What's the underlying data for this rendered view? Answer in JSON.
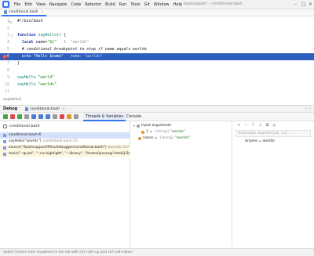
{
  "menubar": {
    "items": [
      "File",
      "Edit",
      "View",
      "Navigate",
      "Code",
      "Refactor",
      "Build",
      "Run",
      "Tools",
      "Git",
      "Window",
      "Help"
    ],
    "window_title": "bashsupport – conditional.bash"
  },
  "editor": {
    "tab_label": "conditional.bash",
    "lines": [
      {
        "n": "1",
        "text": "#!/bin/bash"
      },
      {
        "n": "2",
        "text": ""
      },
      {
        "n": "3",
        "text": "function sayHello() {"
      },
      {
        "n": "4",
        "text": "  local name=\"$1\"",
        "hint": "1: \"worlds\""
      },
      {
        "n": "5",
        "text": "  # conditional breakpoint to stop if name equals worlds"
      },
      {
        "n": "6",
        "text": "  echo \"Hello $name\"",
        "hint": "name: \"worlds\""
      },
      {
        "n": "7",
        "text": "}"
      },
      {
        "n": "8",
        "text": ""
      },
      {
        "n": "9",
        "text": "sayHello \"world\""
      },
      {
        "n": "10",
        "text": "sayHello \"worlds\""
      },
      {
        "n": "11",
        "text": ""
      }
    ],
    "breadcrumb": "sayHello()"
  },
  "debug": {
    "title": "Debug",
    "session_tab": "conditional.bash",
    "tabs": {
      "threads_variables": "Threads & Variables",
      "console": "Console"
    },
    "thread": "conditional.bash",
    "frames": [
      {
        "name": "conditional.bash:6",
        "loc": ""
      },
      {
        "name": "sayHello(\"worlds\")",
        "loc": "conditional.bash:10"
      },
      {
        "name": "source(\"/bashsupport/files/debugger/conditional.bash\")",
        "loc": "bashdb:107"
      },
      {
        "name": "main(\"--quiet\", \"--no-highlight\", \"--library\", \"/home/jansorg/.IntelliJ-Scr",
        "loc": ""
      }
    ],
    "variables": {
      "input_args_label": "Input arguments",
      "arg1_name": "1",
      "arg1_type": "{string}",
      "arg1_value": "\"worlds\"",
      "name_name": "name",
      "name_type": "{string}",
      "name_value": "\"worlds\""
    },
    "watches": {
      "tools": [
        "+",
        "−",
        "↑",
        "↓",
        "⧉",
        "◎"
      ],
      "eval_placeholder": "Evaluate expression (↵) ...",
      "watch_name": "$name",
      "watch_eq": "=",
      "watch_value": "worlds"
    }
  },
  "status": {
    "text": "switch frames from anywhere in the ide with ctrl+alt+up and ctrl+alt+down"
  }
}
